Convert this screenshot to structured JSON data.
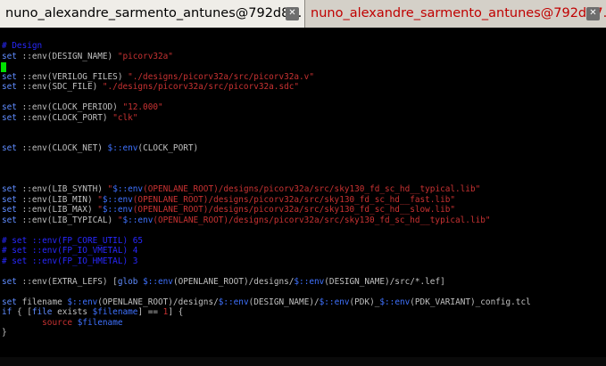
{
  "colors": {
    "background": "#000000",
    "text": "#c0c0c0",
    "keyword": "#5f8cff",
    "string": "#c83232",
    "comment": "#2828ff",
    "variable": "#3f72ff",
    "cursor": "#00e000",
    "active_tab_text": "#000000",
    "inactive_tab_text": "#c00000"
  },
  "tabs": [
    {
      "label": "nuno_alexandre_sarmento_antunes@792d8...",
      "close_icon": "close-icon",
      "active": true
    },
    {
      "label": "nuno_alexandre_sarmento_antunes@792d87...",
      "close_icon": "close-icon",
      "active": false
    }
  ],
  "editor": {
    "lines": [
      [
        {
          "t": "# Design",
          "c": "comment"
        }
      ],
      [
        {
          "t": "set",
          "c": "keyword"
        },
        {
          "t": " ::env(DESIGN_NAME) ",
          "c": "text"
        },
        {
          "t": "\"picorv32a\"",
          "c": "string"
        }
      ],
      [],
      [
        {
          "t": "set",
          "c": "keyword"
        },
        {
          "t": " ::env(VERILOG_FILES) ",
          "c": "text"
        },
        {
          "t": "\"./designs/picorv32a/src/picorv32a.v\"",
          "c": "string"
        }
      ],
      [
        {
          "t": "set",
          "c": "keyword"
        },
        {
          "t": " ::env(SDC_FILE) ",
          "c": "text"
        },
        {
          "t": "\"./designs/picorv32a/src/picorv32a.sdc\"",
          "c": "string"
        }
      ],
      [],
      [
        {
          "t": "set",
          "c": "keyword"
        },
        {
          "t": " ::env(CLOCK_PERIOD) ",
          "c": "text"
        },
        {
          "t": "\"12.000\"",
          "c": "string"
        }
      ],
      [
        {
          "t": "set",
          "c": "keyword"
        },
        {
          "t": " ::env(CLOCK_PORT) ",
          "c": "text"
        },
        {
          "t": "\"clk\"",
          "c": "string"
        }
      ],
      [],
      [],
      [
        {
          "t": "set",
          "c": "keyword"
        },
        {
          "t": " ::env(CLOCK_NET) ",
          "c": "text"
        },
        {
          "t": "$::env",
          "c": "variable"
        },
        {
          "t": "(CLOCK_PORT)",
          "c": "text"
        }
      ],
      [],
      [],
      [],
      [
        {
          "t": "set",
          "c": "keyword"
        },
        {
          "t": " ::env(LIB_SYNTH) ",
          "c": "text"
        },
        {
          "t": "\"",
          "c": "string"
        },
        {
          "t": "$::env",
          "c": "variable"
        },
        {
          "t": "(OPENLANE_ROOT)/designs/picorv32a/src/sky130_fd_sc_hd__typical.lib\"",
          "c": "string"
        }
      ],
      [
        {
          "t": "set",
          "c": "keyword"
        },
        {
          "t": " ::env(LIB_MIN) ",
          "c": "text"
        },
        {
          "t": "\"",
          "c": "string"
        },
        {
          "t": "$::env",
          "c": "variable"
        },
        {
          "t": "(OPENLANE_ROOT)/designs/picorv32a/src/sky130_fd_sc_hd__fast.lib\"",
          "c": "string"
        }
      ],
      [
        {
          "t": "set",
          "c": "keyword"
        },
        {
          "t": " ::env(LIB_MAX) ",
          "c": "text"
        },
        {
          "t": "\"",
          "c": "string"
        },
        {
          "t": "$::env",
          "c": "variable"
        },
        {
          "t": "(OPENLANE_ROOT)/designs/picorv32a/src/sky130_fd_sc_hd__slow.lib\"",
          "c": "string"
        }
      ],
      [
        {
          "t": "set",
          "c": "keyword"
        },
        {
          "t": " ::env(LIB_TYPICAL) ",
          "c": "text"
        },
        {
          "t": "\"",
          "c": "string"
        },
        {
          "t": "$::env",
          "c": "variable"
        },
        {
          "t": "(OPENLANE_ROOT)/designs/picorv32a/src/sky130_fd_sc_hd__typical.lib\"",
          "c": "string"
        }
      ],
      [],
      [
        {
          "t": "# set ::env(FP_CORE_UTIL) 65",
          "c": "comment"
        }
      ],
      [
        {
          "t": "# set ::env(FP_IO_VMETAL) 4",
          "c": "comment"
        }
      ],
      [
        {
          "t": "# set ::env(FP_IO_HMETAL) 3",
          "c": "comment"
        }
      ],
      [],
      [
        {
          "t": "set",
          "c": "keyword"
        },
        {
          "t": " ::env(EXTRA_LEFS) [",
          "c": "text"
        },
        {
          "t": "glob",
          "c": "keyword"
        },
        {
          "t": " ",
          "c": "text"
        },
        {
          "t": "$::env",
          "c": "variable"
        },
        {
          "t": "(OPENLANE_ROOT)/designs/",
          "c": "text"
        },
        {
          "t": "$::env",
          "c": "variable"
        },
        {
          "t": "(DESIGN_NAME)/src/*.lef]",
          "c": "text"
        }
      ],
      [],
      [
        {
          "t": "set",
          "c": "keyword"
        },
        {
          "t": " filename ",
          "c": "text"
        },
        {
          "t": "$::env",
          "c": "variable"
        },
        {
          "t": "(OPENLANE_ROOT)/designs/",
          "c": "text"
        },
        {
          "t": "$::env",
          "c": "variable"
        },
        {
          "t": "(DESIGN_NAME)/",
          "c": "text"
        },
        {
          "t": "$::env",
          "c": "variable"
        },
        {
          "t": "(PDK)_",
          "c": "text"
        },
        {
          "t": "$::env",
          "c": "variable"
        },
        {
          "t": "(PDK_VARIANT)_config.tcl",
          "c": "text"
        }
      ],
      [
        {
          "t": "if",
          "c": "keyword"
        },
        {
          "t": " { [",
          "c": "text"
        },
        {
          "t": "file",
          "c": "keyword"
        },
        {
          "t": " exists ",
          "c": "text"
        },
        {
          "t": "$filename",
          "c": "variable"
        },
        {
          "t": "] == ",
          "c": "text"
        },
        {
          "t": "1",
          "c": "string"
        },
        {
          "t": "] {",
          "c": "text"
        }
      ],
      [
        {
          "t": "        ",
          "c": "text"
        },
        {
          "t": "source",
          "c": "string"
        },
        {
          "t": " ",
          "c": "text"
        },
        {
          "t": "$filename",
          "c": "variable"
        }
      ],
      [
        {
          "t": "}",
          "c": "text"
        }
      ]
    ]
  }
}
